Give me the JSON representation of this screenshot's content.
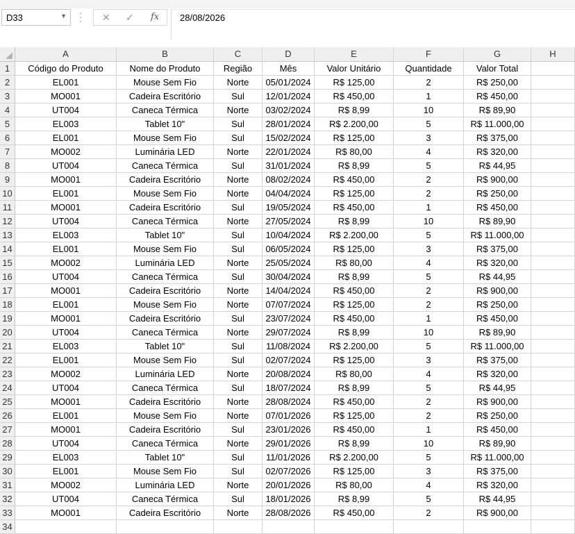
{
  "name_box": {
    "value": "D33"
  },
  "formula_bar": {
    "value": "28/08/2026"
  },
  "columns": [
    "A",
    "B",
    "C",
    "D",
    "E",
    "F",
    "G",
    "H"
  ],
  "row_numbers": [
    "1",
    "2",
    "3",
    "4",
    "5",
    "6",
    "7",
    "8",
    "9",
    "10",
    "11",
    "12",
    "13",
    "14",
    "15",
    "16",
    "17",
    "18",
    "19",
    "20",
    "21",
    "22",
    "23",
    "24",
    "25",
    "26",
    "27",
    "28",
    "29",
    "30",
    "31",
    "32",
    "33",
    "34"
  ],
  "header_row": [
    "Código do Produto",
    "Nome do Produto",
    "Região",
    "Mês",
    "Valor Unitário",
    "Quantidade",
    "Valor Total",
    ""
  ],
  "rows": [
    [
      "EL001",
      "Mouse Sem Fio",
      "Norte",
      "05/01/2024",
      "R$ 125,00",
      "2",
      "R$ 250,00",
      ""
    ],
    [
      "MO001",
      "Cadeira Escritório",
      "Sul",
      "12/01/2024",
      "R$ 450,00",
      "1",
      "R$ 450,00",
      ""
    ],
    [
      "UT004",
      "Caneca Térmica",
      "Norte",
      "03/02/2024",
      "R$ 8,99",
      "10",
      "R$ 89,90",
      ""
    ],
    [
      "EL003",
      "Tablet 10\"",
      "Sul",
      "28/01/2024",
      "R$ 2.200,00",
      "5",
      "R$ 11.000,00",
      ""
    ],
    [
      "EL001",
      "Mouse Sem Fio",
      "Sul",
      "15/02/2024",
      "R$ 125,00",
      "3",
      "R$ 375,00",
      ""
    ],
    [
      "MO002",
      "Luminária LED",
      "Norte",
      "22/01/2024",
      "R$ 80,00",
      "4",
      "R$ 320,00",
      ""
    ],
    [
      "UT004",
      "Caneca Térmica",
      "Sul",
      "31/01/2024",
      "R$ 8,99",
      "5",
      "R$ 44,95",
      ""
    ],
    [
      "MO001",
      "Cadeira Escritório",
      "Norte",
      "08/02/2024",
      "R$ 450,00",
      "2",
      "R$ 900,00",
      ""
    ],
    [
      "EL001",
      "Mouse Sem Fio",
      "Norte",
      "04/04/2024",
      "R$ 125,00",
      "2",
      "R$ 250,00",
      ""
    ],
    [
      "MO001",
      "Cadeira Escritório",
      "Sul",
      "19/05/2024",
      "R$ 450,00",
      "1",
      "R$ 450,00",
      ""
    ],
    [
      "UT004",
      "Caneca Térmica",
      "Norte",
      "27/05/2024",
      "R$ 8,99",
      "10",
      "R$ 89,90",
      ""
    ],
    [
      "EL003",
      "Tablet 10\"",
      "Sul",
      "10/04/2024",
      "R$ 2.200,00",
      "5",
      "R$ 11.000,00",
      ""
    ],
    [
      "EL001",
      "Mouse Sem Fio",
      "Sul",
      "06/05/2024",
      "R$ 125,00",
      "3",
      "R$ 375,00",
      ""
    ],
    [
      "MO002",
      "Luminária LED",
      "Norte",
      "25/05/2024",
      "R$ 80,00",
      "4",
      "R$ 320,00",
      ""
    ],
    [
      "UT004",
      "Caneca Térmica",
      "Sul",
      "30/04/2024",
      "R$ 8,99",
      "5",
      "R$ 44,95",
      ""
    ],
    [
      "MO001",
      "Cadeira Escritório",
      "Norte",
      "14/04/2024",
      "R$ 450,00",
      "2",
      "R$ 900,00",
      ""
    ],
    [
      "EL001",
      "Mouse Sem Fio",
      "Norte",
      "07/07/2024",
      "R$ 125,00",
      "2",
      "R$ 250,00",
      ""
    ],
    [
      "MO001",
      "Cadeira Escritório",
      "Sul",
      "23/07/2024",
      "R$ 450,00",
      "1",
      "R$ 450,00",
      ""
    ],
    [
      "UT004",
      "Caneca Térmica",
      "Norte",
      "29/07/2024",
      "R$ 8,99",
      "10",
      "R$ 89,90",
      ""
    ],
    [
      "EL003",
      "Tablet 10\"",
      "Sul",
      "11/08/2024",
      "R$ 2.200,00",
      "5",
      "R$ 11.000,00",
      ""
    ],
    [
      "EL001",
      "Mouse Sem Fio",
      "Sul",
      "02/07/2024",
      "R$ 125,00",
      "3",
      "R$ 375,00",
      ""
    ],
    [
      "MO002",
      "Luminária LED",
      "Norte",
      "20/08/2024",
      "R$ 80,00",
      "4",
      "R$ 320,00",
      ""
    ],
    [
      "UT004",
      "Caneca Térmica",
      "Sul",
      "18/07/2024",
      "R$ 8,99",
      "5",
      "R$ 44,95",
      ""
    ],
    [
      "MO001",
      "Cadeira Escritório",
      "Norte",
      "28/08/2024",
      "R$ 450,00",
      "2",
      "R$ 900,00",
      ""
    ],
    [
      "EL001",
      "Mouse Sem Fio",
      "Norte",
      "07/01/2026",
      "R$ 125,00",
      "2",
      "R$ 250,00",
      ""
    ],
    [
      "MO001",
      "Cadeira Escritório",
      "Sul",
      "23/01/2026",
      "R$ 450,00",
      "1",
      "R$ 450,00",
      ""
    ],
    [
      "UT004",
      "Caneca Térmica",
      "Norte",
      "29/01/2026",
      "R$ 8,99",
      "10",
      "R$ 89,90",
      ""
    ],
    [
      "EL003",
      "Tablet 10\"",
      "Sul",
      "11/01/2026",
      "R$ 2.200,00",
      "5",
      "R$ 11.000,00",
      ""
    ],
    [
      "EL001",
      "Mouse Sem Fio",
      "Sul",
      "02/07/2026",
      "R$ 125,00",
      "3",
      "R$ 375,00",
      ""
    ],
    [
      "MO002",
      "Luminária LED",
      "Norte",
      "20/01/2026",
      "R$ 80,00",
      "4",
      "R$ 320,00",
      ""
    ],
    [
      "UT004",
      "Caneca Térmica",
      "Sul",
      "18/01/2026",
      "R$ 8,99",
      "5",
      "R$ 44,95",
      ""
    ],
    [
      "MO001",
      "Cadeira Escritório",
      "Norte",
      "28/08/2026",
      "R$ 450,00",
      "2",
      "R$ 900,00",
      ""
    ],
    [
      "",
      "",
      "",
      "",
      "",
      "",
      "",
      ""
    ]
  ]
}
